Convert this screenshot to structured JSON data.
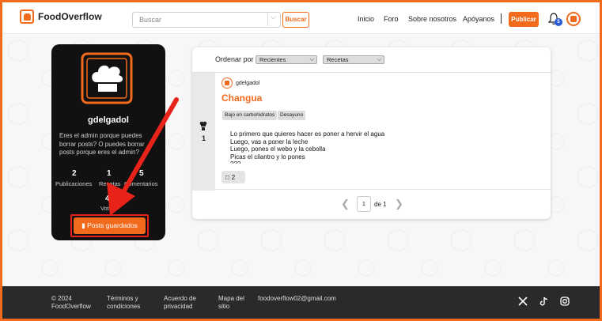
{
  "header": {
    "brand": "FoodOverflow",
    "search_placeholder": "Buscar",
    "search_button": "Buscar",
    "nav": [
      "Inicio",
      "Foro",
      "Sobre nosotros",
      "Apóyanos"
    ],
    "publish_button": "Publicar",
    "notifications_count": "5"
  },
  "profile": {
    "username": "gdelgadol",
    "bio": "Eres el admin porque puedes borrar posts? O puedes borrar posts porque eres el admin?",
    "stats": [
      {
        "value": "2",
        "label": "Publicaciones"
      },
      {
        "value": "1",
        "label": "Recetas"
      },
      {
        "value": "5",
        "label": "Comentarios"
      },
      {
        "value": "4",
        "label": "Votos"
      }
    ],
    "saved_button": "Posts guardados"
  },
  "feed": {
    "sort_label": "Ordenar por",
    "sort_value": "Recientes",
    "filter_value": "Recetas",
    "post": {
      "author": "gdelgadol",
      "title": "Changua",
      "tags": [
        "Bajo en carbohidratos",
        "Desayuno"
      ],
      "steps": [
        "Lo primero que quieres hacer es poner a hervir el agua",
        "Luego, vas a poner la leche",
        "Luego, pones el webo y la cebolla",
        "Picas el cilantro y lo pones",
        "???"
      ],
      "votes": "1",
      "comments": "2"
    },
    "pagination": {
      "current": "1",
      "total_text": "de 1"
    }
  },
  "footer": {
    "copyright": "© 2024 FoodOverflow",
    "terms": "Términos y condiciones",
    "privacy": "Acuerdo de privacidad",
    "sitemap": "Mapa del sitio",
    "email": "foodoverflow02@gmail.com"
  },
  "colors": {
    "accent": "#f26a1b",
    "annotation": "#e8231a",
    "footer_bg": "#2a2a2a"
  }
}
